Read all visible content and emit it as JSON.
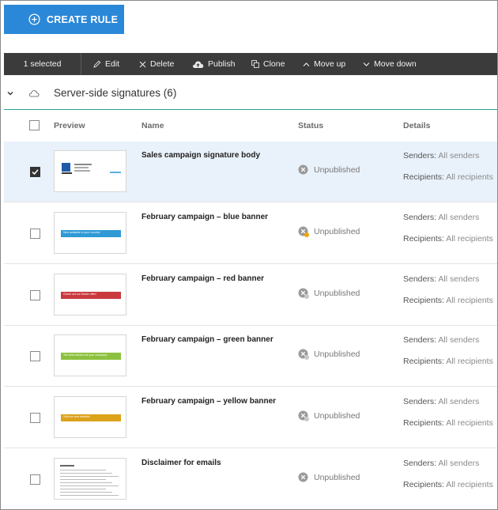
{
  "create_button": {
    "label": "CREATE RULE"
  },
  "toolbar": {
    "selected": "1 selected",
    "edit": "Edit",
    "delete": "Delete",
    "publish": "Publish",
    "clone": "Clone",
    "move_up": "Move up",
    "move_down": "Move down"
  },
  "group": {
    "title": "Server-side signatures (6)"
  },
  "columns": {
    "preview": "Preview",
    "name": "Name",
    "status": "Status",
    "details": "Details"
  },
  "rows": [
    {
      "name": "Sales campaign signature body",
      "status": "Unpublished",
      "senders_label": "Senders:",
      "senders": "All senders",
      "recipients_label": "Recipients:",
      "recipients": "All recipients",
      "selected": true,
      "preview": "signature",
      "pending": false
    },
    {
      "name": "February campaign – blue banner",
      "status": "Unpublished",
      "senders_label": "Senders:",
      "senders": "All senders",
      "recipients_label": "Recipients:",
      "recipients": "All recipients",
      "selected": false,
      "preview": "banner",
      "banner_color": "#2f9ad6",
      "banner_text": "New available in your country!",
      "pending": true
    },
    {
      "name": "February campaign – red banner",
      "status": "Unpublished",
      "senders_label": "Senders:",
      "senders": "All senders",
      "recipients_label": "Recipients:",
      "recipients": "All recipients",
      "selected": false,
      "preview": "banner",
      "banner_color": "#c93a3f",
      "banner_text": "Check out our Easter offer!",
      "pending": false
    },
    {
      "name": "February campaign – green banner",
      "status": "Unpublished",
      "senders_label": "Senders:",
      "senders": "All senders",
      "recipients_label": "Recipients:",
      "recipients": "All recipients",
      "selected": false,
      "preview": "banner",
      "banner_color": "#8cc13f",
      "banner_text": "The best solution for your company!",
      "pending": false
    },
    {
      "name": "February campaign – yellow banner",
      "status": "Unpublished",
      "senders_label": "Senders:",
      "senders": "All senders",
      "recipients_label": "Recipients:",
      "recipients": "All recipients",
      "selected": false,
      "preview": "banner",
      "banner_color": "#dca21c",
      "banner_text": "Visit our new website!",
      "pending": false
    },
    {
      "name": "Disclaimer for emails",
      "status": "Unpublished",
      "senders_label": "Senders:",
      "senders": "All senders",
      "recipients_label": "Recipients:",
      "recipients": "All recipients",
      "selected": false,
      "preview": "disclaimer",
      "pending": false
    }
  ],
  "colors": {
    "accent": "#2b88d8",
    "toolbar_bg": "#3b3b3b",
    "group_line": "#2aa198",
    "selected_row": "#e9f2fb",
    "pending_badge": "#f0a30a"
  }
}
